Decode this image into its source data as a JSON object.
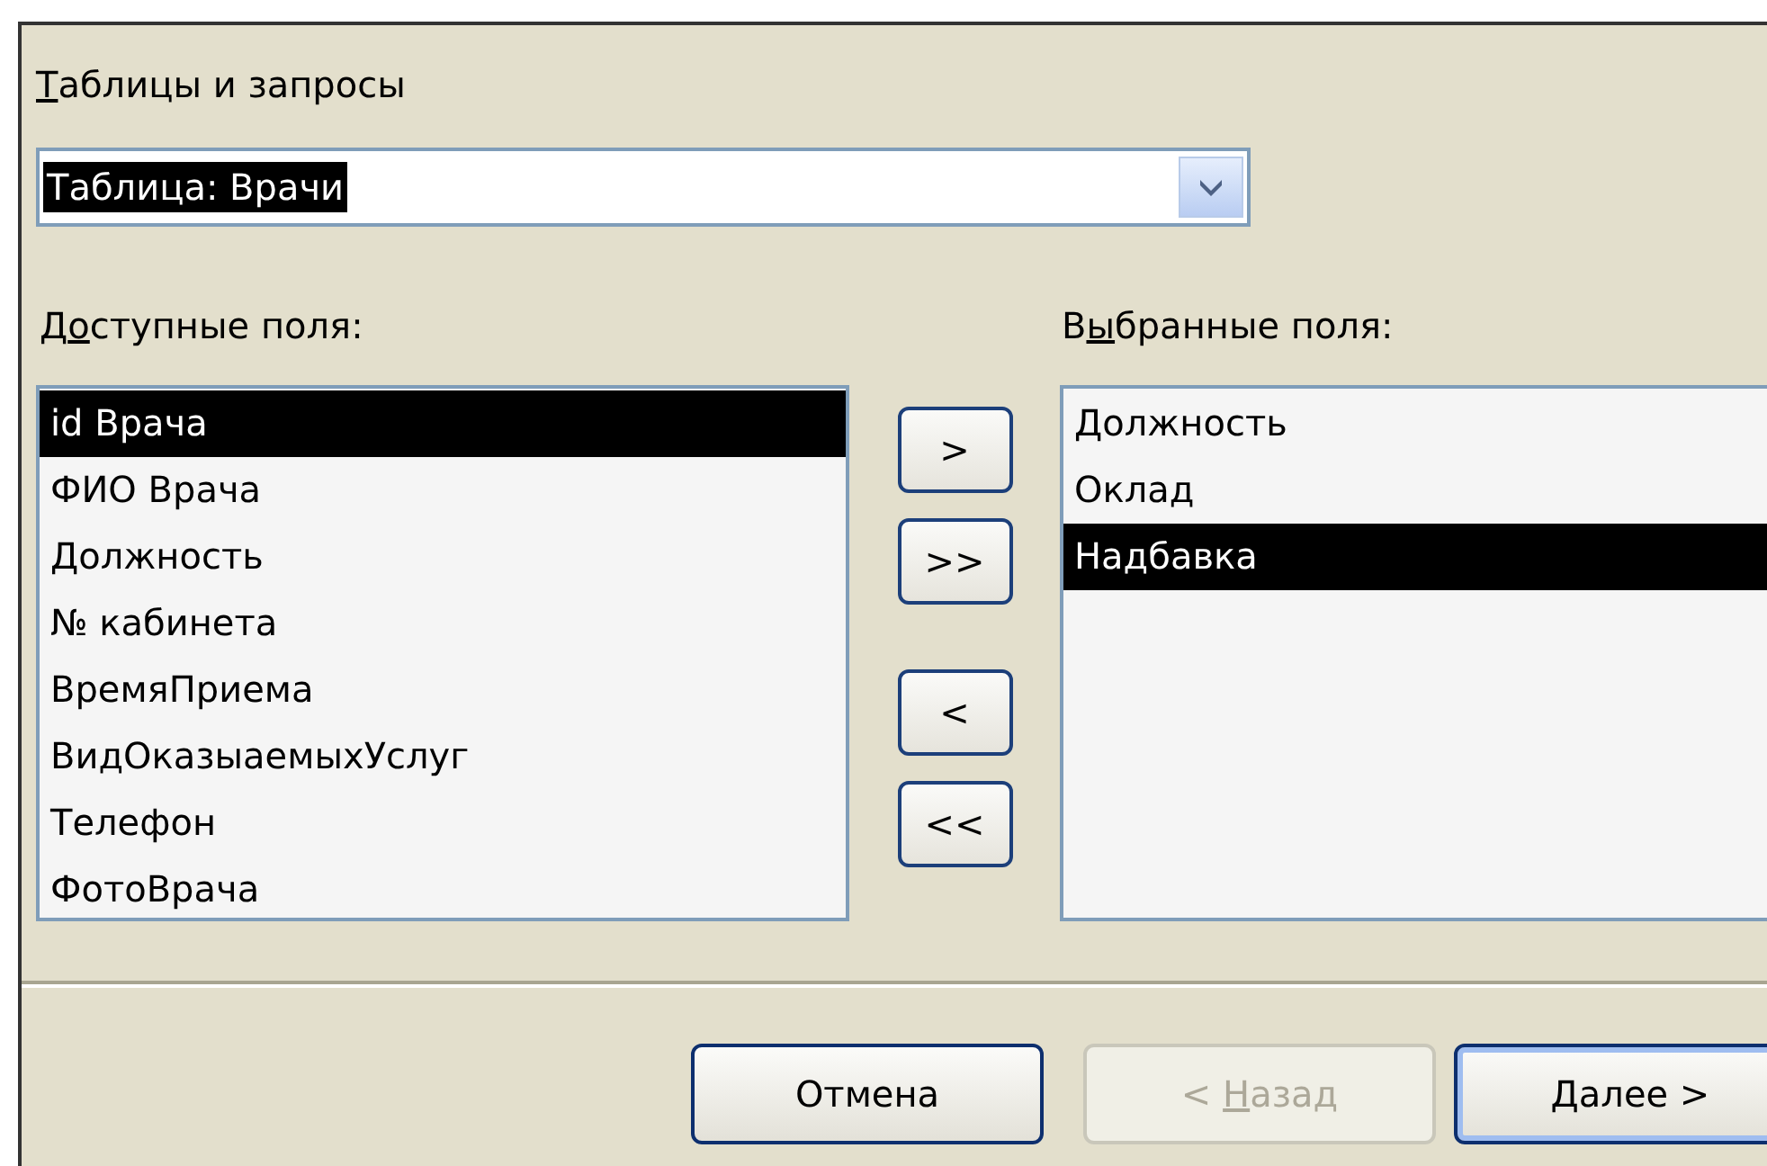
{
  "source_label": {
    "key": "Т",
    "post": "аблицы и запросы"
  },
  "source_combo": {
    "value": "Таблица: Врачи"
  },
  "available_label": {
    "pre": "Д",
    "key": "о",
    "post": "ступные поля:"
  },
  "selected_label": {
    "pre": "В",
    "key": "ы",
    "post": "бранные поля:"
  },
  "available_fields": [
    {
      "label": "id Врача",
      "selected": true
    },
    {
      "label": "ФИО Врача",
      "selected": false
    },
    {
      "label": "Должность",
      "selected": false
    },
    {
      "label": "№ кабинета",
      "selected": false
    },
    {
      "label": "ВремяПриема",
      "selected": false
    },
    {
      "label": "ВидОказыаемыхУслуг",
      "selected": false
    },
    {
      "label": "Телефон",
      "selected": false
    },
    {
      "label": "ФотоВрача",
      "selected": false
    }
  ],
  "move_buttons": [
    ">",
    ">>",
    "<",
    "<<"
  ],
  "selected_fields": [
    {
      "label": "Должность",
      "selected": false
    },
    {
      "label": "Оклад",
      "selected": false
    },
    {
      "label": "Надбавка",
      "selected": true
    }
  ],
  "buttons": [
    {
      "post": "Отмена",
      "disabled": false,
      "default": false
    },
    {
      "pre": "< ",
      "key": "Н",
      "post": "азад",
      "disabled": true,
      "default": false
    },
    {
      "key": "Д",
      "post": "алее >",
      "disabled": false,
      "default": true
    }
  ]
}
